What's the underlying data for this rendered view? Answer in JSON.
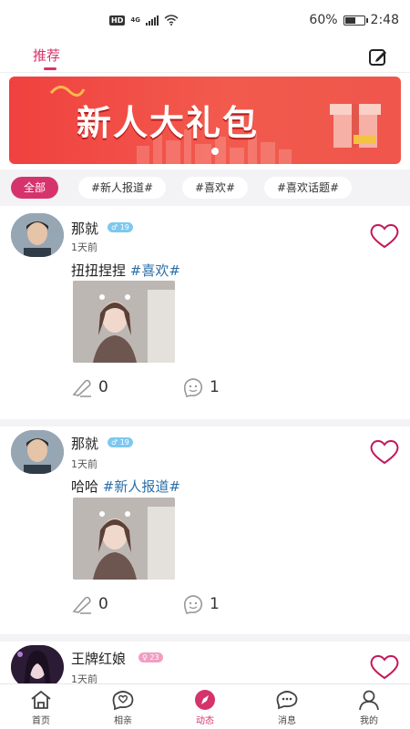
{
  "status_bar": {
    "network": "4G",
    "hd_badge": "HD",
    "battery_text": "60%",
    "battery_level": 0.6,
    "time": "2:48"
  },
  "top_nav": {
    "recommend_tab": "推荐"
  },
  "banner": {
    "title": "新人大礼包"
  },
  "tags": [
    "全部",
    "#新人报道#",
    "#喜欢#",
    "#喜欢话题#"
  ],
  "posts": [
    {
      "username": "那就",
      "gender": "♂",
      "age": "19",
      "time": "1天前",
      "text": "扭扭捏捏",
      "hashtag": "#喜欢#",
      "comments": "0",
      "likes": "1"
    },
    {
      "username": "那就",
      "gender": "♂",
      "age": "19",
      "time": "1天前",
      "text": "哈哈",
      "hashtag": "#新人报道#",
      "comments": "0",
      "likes": "1"
    },
    {
      "username": "王牌红娘",
      "gender": "♀",
      "age": "23",
      "time": "1天前"
    }
  ],
  "bottom_nav": [
    "首页",
    "相亲",
    "动态",
    "消息",
    "我的"
  ],
  "colors": {
    "accent": "#d6336c",
    "hashtag": "#2c6fa8",
    "male_badge": "#7ec8ee",
    "female_badge": "#f19ec2",
    "banner_red": "#f0413f"
  }
}
